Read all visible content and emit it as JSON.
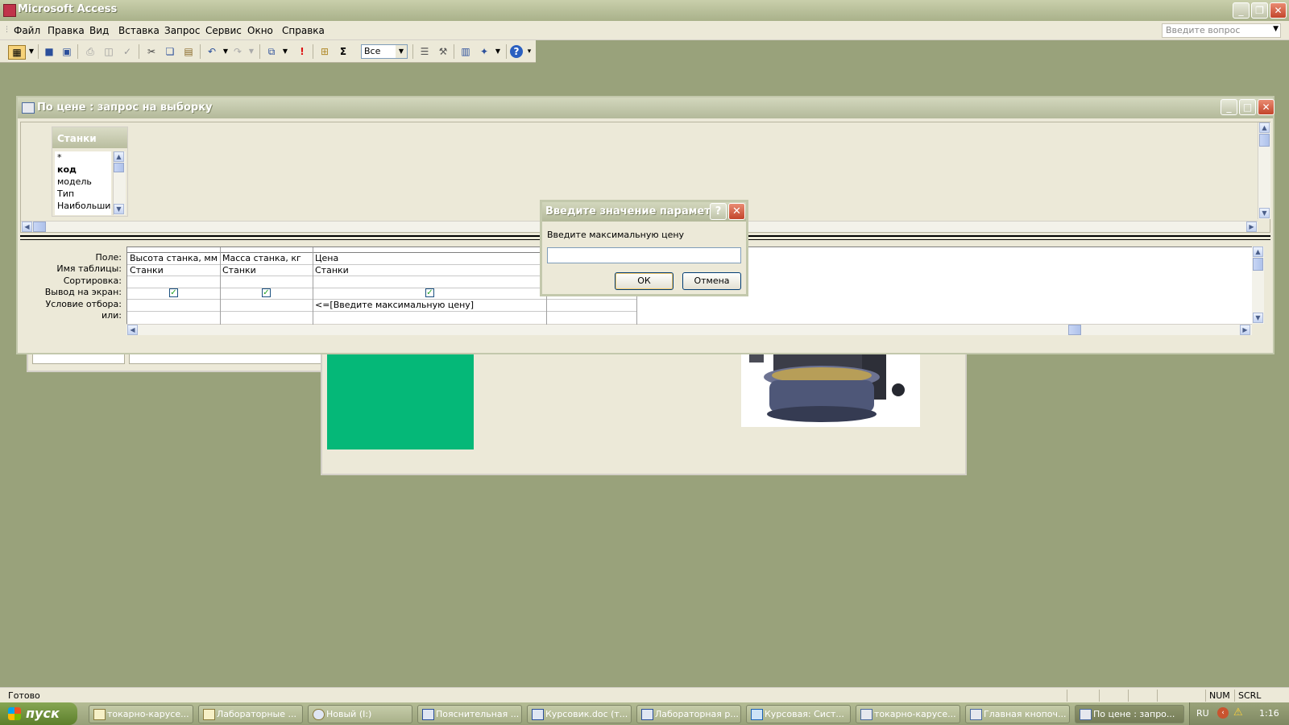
{
  "app": {
    "title": "Microsoft Access"
  },
  "menu": {
    "items": [
      "Файл",
      "Правка",
      "Вид",
      "Вставка",
      "Запрос",
      "Сервис",
      "Окно",
      "Справка"
    ],
    "ask_placeholder": "Введите вопрос"
  },
  "toolbar": {
    "scope_value": "Все",
    "icons": [
      "view-icon",
      "save-icon",
      "save-as-icon",
      "print-icon",
      "preview-icon",
      "spell-icon",
      "cut-icon",
      "copy-icon",
      "paste-icon",
      "undo-icon",
      "redo-icon",
      "query-type-icon",
      "run-icon",
      "show-table-icon",
      "totals-icon",
      "properties-icon",
      "build-icon",
      "database-window-icon",
      "new-object-icon",
      "help-icon"
    ]
  },
  "query_window": {
    "title": "По цене : запрос на выборку",
    "table": {
      "name": "Станки",
      "fields": [
        "*",
        "код",
        "модель",
        "Тип",
        "Наибольший"
      ]
    },
    "grid": {
      "row_labels": [
        "Поле:",
        "Имя таблицы:",
        "Сортировка:",
        "Вывод на экран:",
        "Условие отбора:",
        "или:"
      ],
      "columns": [
        {
          "field": "Высота станка, мм",
          "table": "Станки",
          "sort": "",
          "show": true,
          "criteria": ""
        },
        {
          "field": "Масса станка, кг",
          "table": "Станки",
          "sort": "",
          "show": true,
          "criteria": ""
        },
        {
          "field": "Цена",
          "table": "Станки",
          "sort": "",
          "show": true,
          "criteria": "<=[Введите максимальную цену]"
        },
        {
          "field": "",
          "table": "",
          "sort": "",
          "show": false,
          "criteria": ""
        }
      ]
    }
  },
  "dialog": {
    "title": "Введите значение параметра",
    "prompt": "Введите максимальную цену",
    "value": "",
    "ok_label": "ОК",
    "cancel_label": "Отмена"
  },
  "status": {
    "text": "Готово",
    "indicators": [
      "NUM",
      "SCRL"
    ]
  },
  "taskbar": {
    "start_label": "пуск",
    "tasks": [
      "токарно-карусе...",
      "Лабораторные ...",
      "Новый (I:)",
      "Пояснительная ...",
      "Курсовик.doc (т...",
      "Лабораторная р...",
      "Курсовая: Сист...",
      "токарно-карусе...",
      "Главная кнопоч...",
      "По цене : запро..."
    ],
    "active_task_index": 9,
    "language": "RU",
    "clock": "1:16"
  }
}
